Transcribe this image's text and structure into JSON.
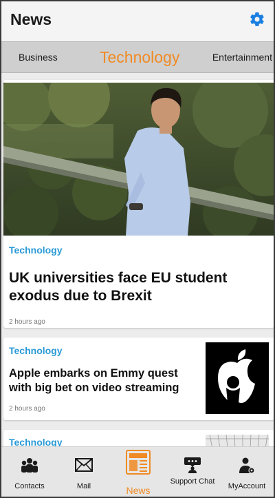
{
  "app": {
    "title": "News"
  },
  "header": {
    "settings_icon": "gear-icon",
    "accent": "#1a7fe0"
  },
  "tabs": [
    {
      "label": "Business",
      "active": false
    },
    {
      "label": "Technology",
      "active": true
    },
    {
      "label": "Entertainment",
      "active": false
    }
  ],
  "colors": {
    "accent_orange": "#f08a24",
    "category_blue": "#2a9ad6"
  },
  "feed": {
    "articles": [
      {
        "category": "Technology",
        "headline": "UK universities face EU student exodus due to Brexit",
        "time": "2 hours ago",
        "image": "man-in-blue-shirt-photo"
      },
      {
        "category": "Technology",
        "headline": "Apple embarks on Emmy quest with big bet on video streaming",
        "time": "2 hours ago",
        "image": "apple-logo-thumbnail"
      },
      {
        "category": "Technology",
        "headline": "",
        "time": "",
        "image": "building-thumbnail"
      }
    ]
  },
  "bottom_nav": [
    {
      "label": "Contacts",
      "icon": "contacts-icon",
      "active": false
    },
    {
      "label": "Mail",
      "icon": "mail-icon",
      "active": false
    },
    {
      "label": "News",
      "icon": "news-icon",
      "active": true
    },
    {
      "label": "Support Chat",
      "icon": "support-chat-icon",
      "active": false
    },
    {
      "label": "MyAccount",
      "icon": "my-account-icon",
      "active": false
    }
  ]
}
